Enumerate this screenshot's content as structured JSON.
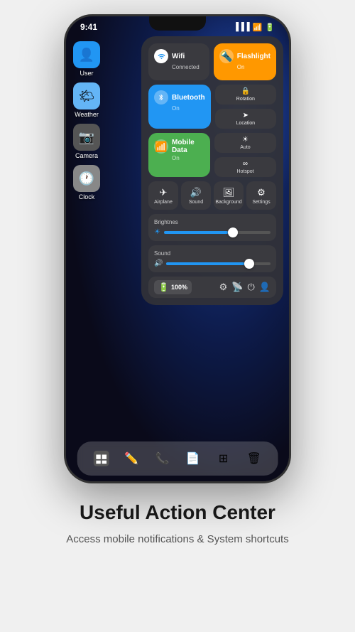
{
  "phone": {
    "notch": true,
    "status": {
      "time": "9:41",
      "icons": [
        "signal",
        "wifi",
        "battery"
      ]
    },
    "apps": [
      {
        "name": "User",
        "icon": "👤",
        "bg": "#2196F3",
        "label": "User"
      },
      {
        "name": "Weather",
        "icon": "🌤",
        "bg": "#64B5F6",
        "label": "Weather"
      },
      {
        "name": "Camera",
        "icon": "📷",
        "bg": "#555",
        "label": "Camera"
      },
      {
        "name": "Clock",
        "icon": "🕐",
        "bg": "#888",
        "label": "Clock"
      }
    ],
    "control_center": {
      "wifi": {
        "label": "Wifi",
        "sub": "Connected",
        "active": true
      },
      "flashlight": {
        "label": "Flashlight",
        "sub": "On",
        "active": true
      },
      "bluetooth": {
        "label": "Bluetooth",
        "sub": "On",
        "active": true
      },
      "rotation": {
        "label": "Rotation",
        "active": true
      },
      "location": {
        "label": "Location",
        "active": true
      },
      "mobile_data": {
        "label": "Mobile Data",
        "sub": "On",
        "active": true
      },
      "auto": {
        "label": "Auto",
        "active": false
      },
      "hotspot": {
        "label": "Hotspot",
        "active": false
      },
      "airplane": {
        "label": "Airplane",
        "active": false
      },
      "sound": {
        "label": "Sound",
        "active": false
      },
      "background": {
        "label": "Background",
        "active": false
      },
      "settings": {
        "label": "Settings",
        "active": false
      },
      "brightness_label": "Brightnes",
      "brightness_value": 60,
      "sound_label": "Sound",
      "sound_value": 75,
      "battery_percent": "100%"
    },
    "dock": [
      "finder",
      "pencil",
      "phone",
      "notes",
      "layout",
      "trash"
    ]
  },
  "page": {
    "title": "Useful Action Center",
    "subtitle": "Access mobile notifications\n& System shortcuts"
  },
  "colors": {
    "blue": "#2196F3",
    "orange": "#FF9800",
    "green": "#4CAF50",
    "dark": "#3a3a3f"
  }
}
